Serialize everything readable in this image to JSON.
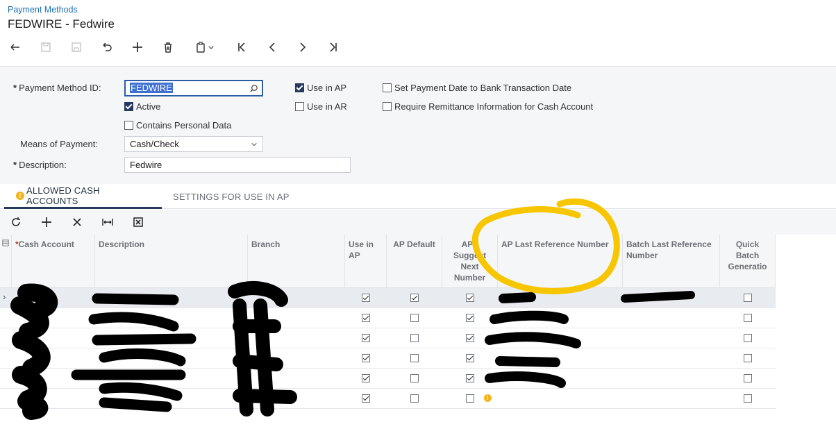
{
  "header": {
    "breadcrumb": "Payment Methods",
    "title": "FEDWIRE - Fedwire"
  },
  "toolbar": {
    "buttons": [
      {
        "name": "back-button",
        "icon": "undo-arrow-icon"
      },
      {
        "name": "save-close-button",
        "icon": "save-close-icon"
      },
      {
        "name": "save-button",
        "icon": "save-icon"
      },
      {
        "name": "cancel-button",
        "icon": "revert-icon"
      },
      {
        "name": "add-button",
        "icon": "plus-icon"
      },
      {
        "name": "delete-button",
        "icon": "trash-icon"
      },
      {
        "name": "copy-paste-button",
        "icon": "clipboard-icon"
      },
      {
        "name": "first-button",
        "icon": "first-record-icon"
      },
      {
        "name": "prev-button",
        "icon": "chevron-left-icon"
      },
      {
        "name": "next-button",
        "icon": "chevron-right-icon"
      },
      {
        "name": "last-button",
        "icon": "last-record-icon"
      }
    ]
  },
  "form": {
    "payment_method_id_label": "Payment Method ID:",
    "payment_method_id_value": "FEDWIRE",
    "active_label": "Active",
    "active_checked": true,
    "contains_personal_data_label": "Contains Personal Data",
    "contains_personal_data_checked": false,
    "means_of_payment_label": "Means of Payment:",
    "means_of_payment_value": "Cash/Check",
    "description_label": "Description:",
    "description_value": "Fedwire",
    "use_in_ap_label": "Use in AP",
    "use_in_ap_checked": true,
    "use_in_ar_label": "Use in AR",
    "use_in_ar_checked": false,
    "set_payment_date_label": "Set Payment Date to Bank Transaction Date",
    "set_payment_date_checked": false,
    "require_remittance_label": "Require Remittance Information for Cash Account",
    "require_remittance_checked": false
  },
  "tabs": [
    {
      "label": "ALLOWED CASH ACCOUNTS",
      "active": true,
      "warning": true
    },
    {
      "label": "SETTINGS FOR USE IN AP",
      "active": false,
      "warning": false
    }
  ],
  "grid": {
    "columns": {
      "cash_account": "Cash Account",
      "description": "Description",
      "branch": "Branch",
      "use_in_ap": "Use in AP",
      "ap_default": "AP Default",
      "ap_suggest_next": "AP - Suggest Next Number",
      "ap_last_ref": "AP Last Reference Number",
      "batch_last_ref": "Batch Last Reference Number",
      "quick_batch": "Quick Batch Generatio"
    },
    "rows": [
      {
        "use_in_ap": true,
        "ap_default": true,
        "suggest_next": true,
        "quick_batch": false,
        "warning": false
      },
      {
        "use_in_ap": true,
        "ap_default": false,
        "suggest_next": true,
        "quick_batch": false,
        "warning": false
      },
      {
        "use_in_ap": true,
        "ap_default": false,
        "suggest_next": true,
        "quick_batch": false,
        "warning": false
      },
      {
        "use_in_ap": true,
        "ap_default": false,
        "suggest_next": true,
        "quick_batch": false,
        "warning": false
      },
      {
        "use_in_ap": true,
        "ap_default": false,
        "suggest_next": true,
        "quick_batch": false,
        "warning": false
      },
      {
        "use_in_ap": true,
        "ap_default": false,
        "suggest_next": false,
        "quick_batch": false,
        "warning": true
      }
    ]
  },
  "colors": {
    "accent": "#27395c",
    "link": "#1a6fb5",
    "highlight_circle": "#f7c600",
    "redaction": "#000000",
    "warning": "#f2b41c"
  }
}
